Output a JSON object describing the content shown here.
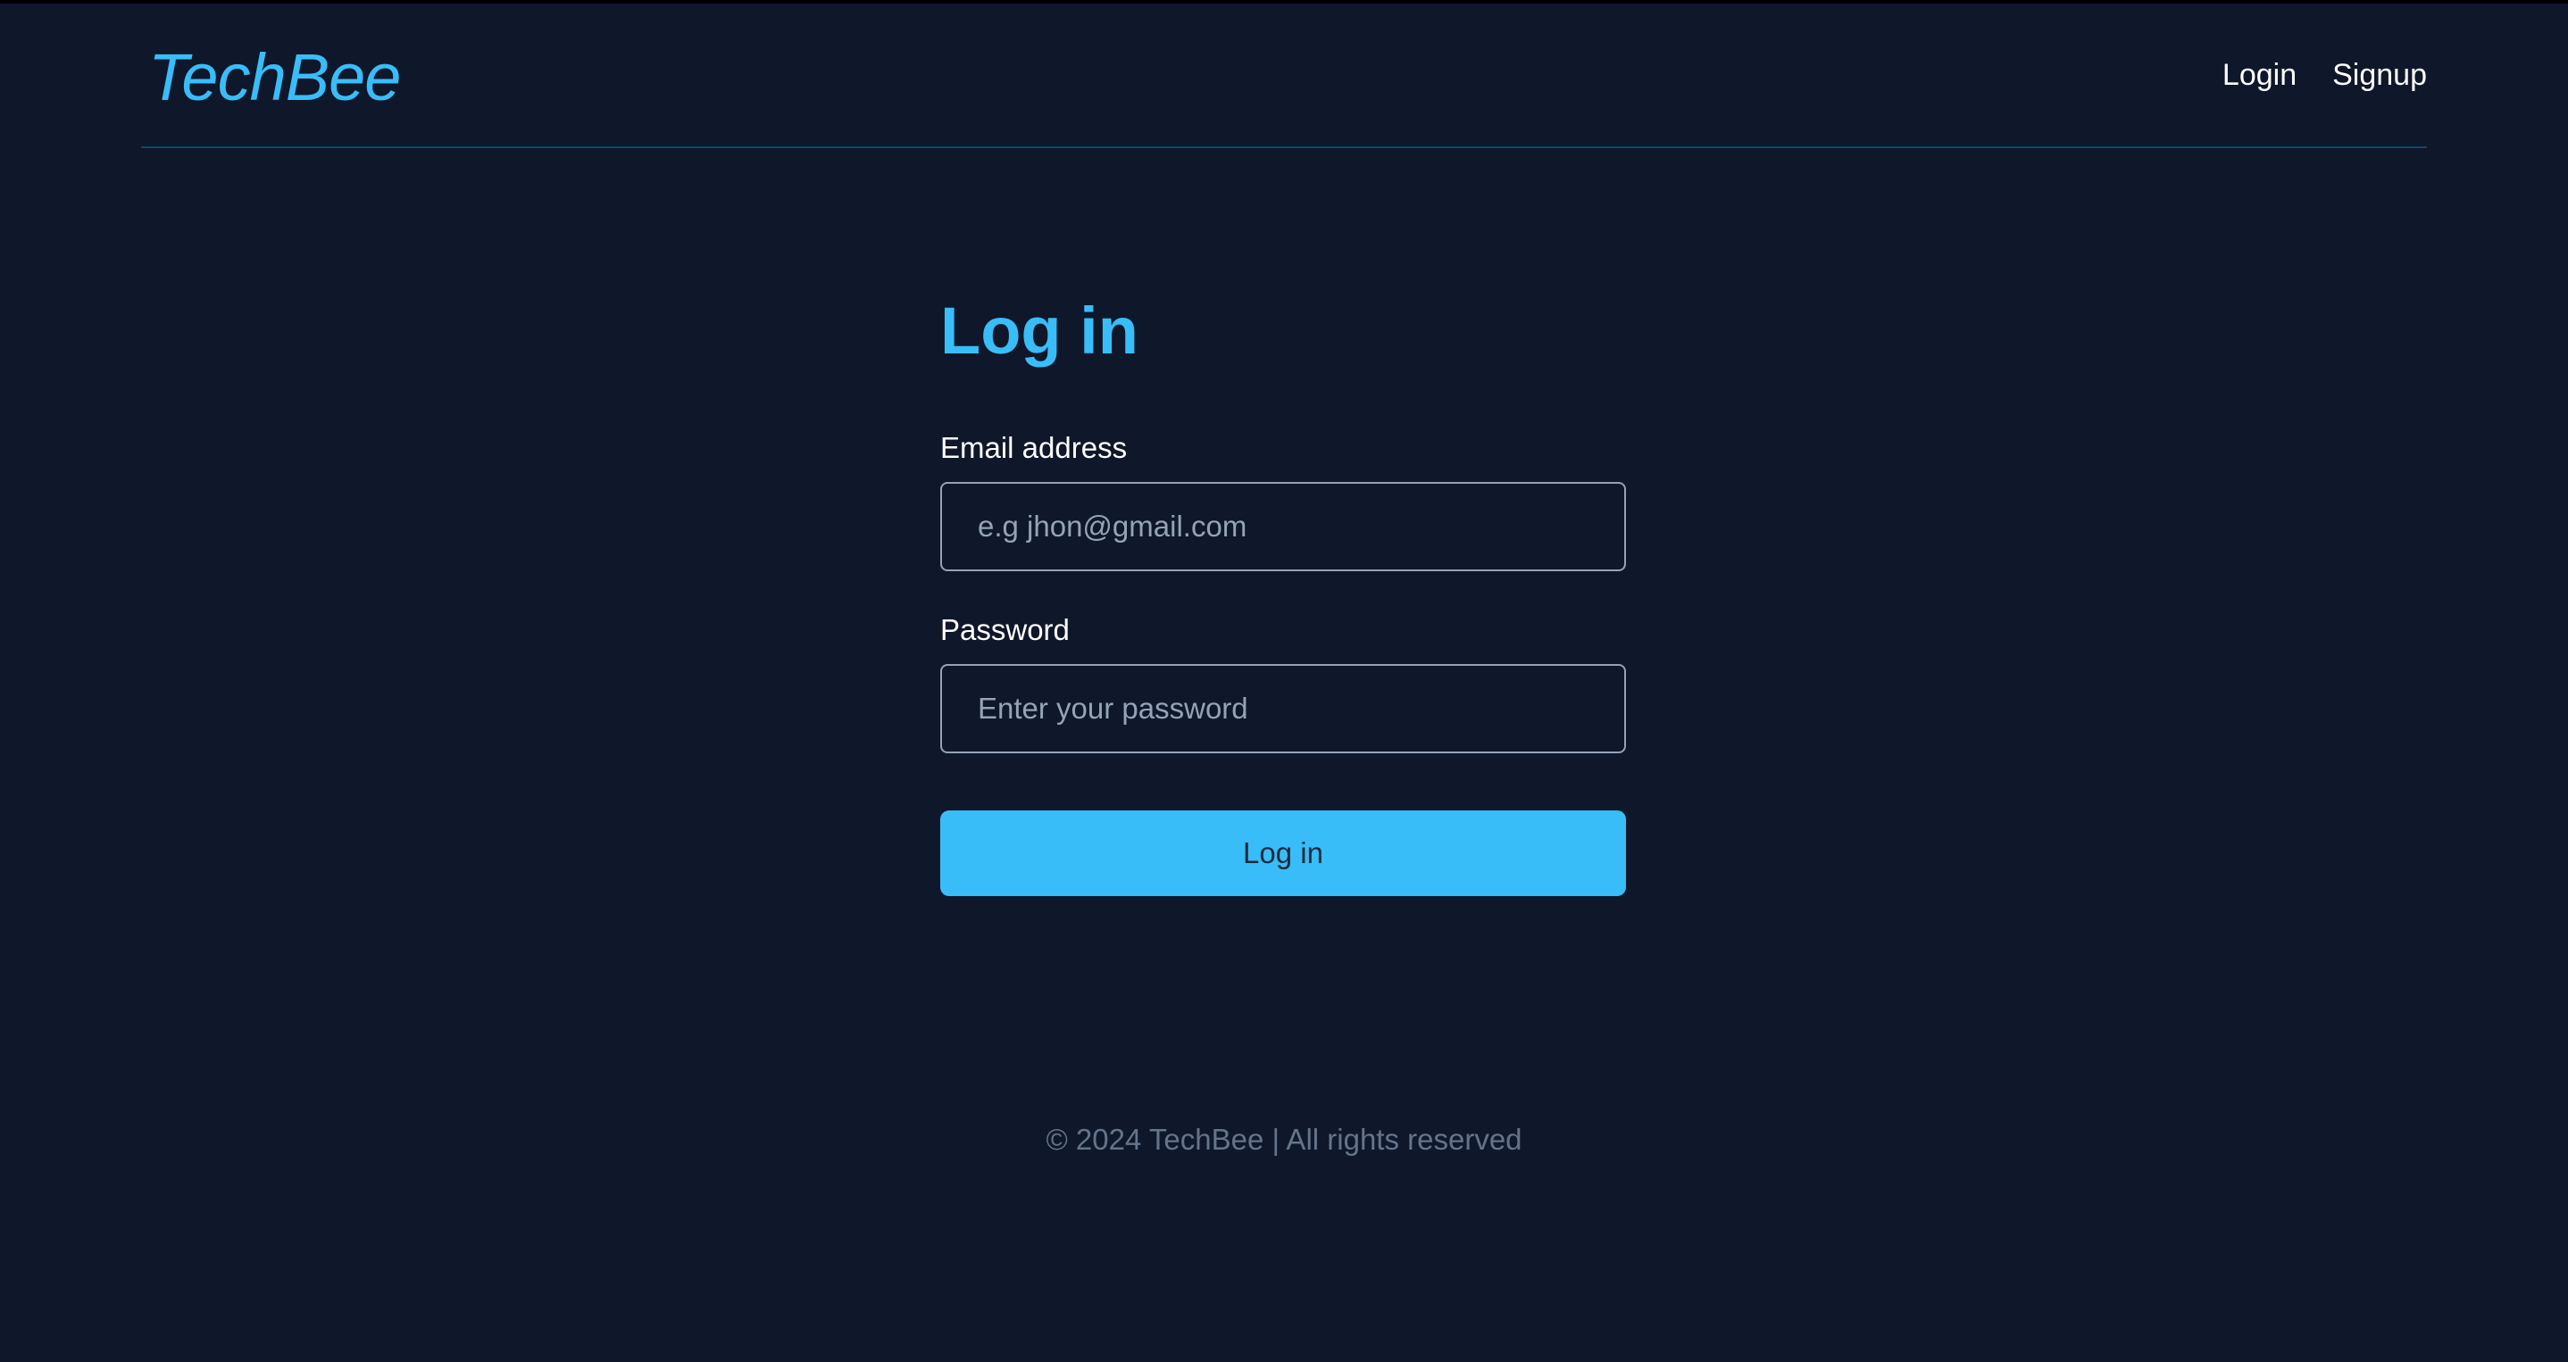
{
  "header": {
    "logo": "TechBee",
    "nav": {
      "login": "Login",
      "signup": "Signup"
    }
  },
  "form": {
    "title": "Log in",
    "email_label": "Email address",
    "email_placeholder": "e.g jhon@gmail.com",
    "email_value": "",
    "password_label": "Password",
    "password_placeholder": "Enter your password",
    "password_value": "",
    "submit_label": "Log in"
  },
  "footer": {
    "text": "© 2024 TechBee | All rights reserved"
  },
  "colors": {
    "background": "#0f172a",
    "accent": "#38bdf8",
    "divider": "#0c4a6e",
    "muted": "#64748b"
  }
}
